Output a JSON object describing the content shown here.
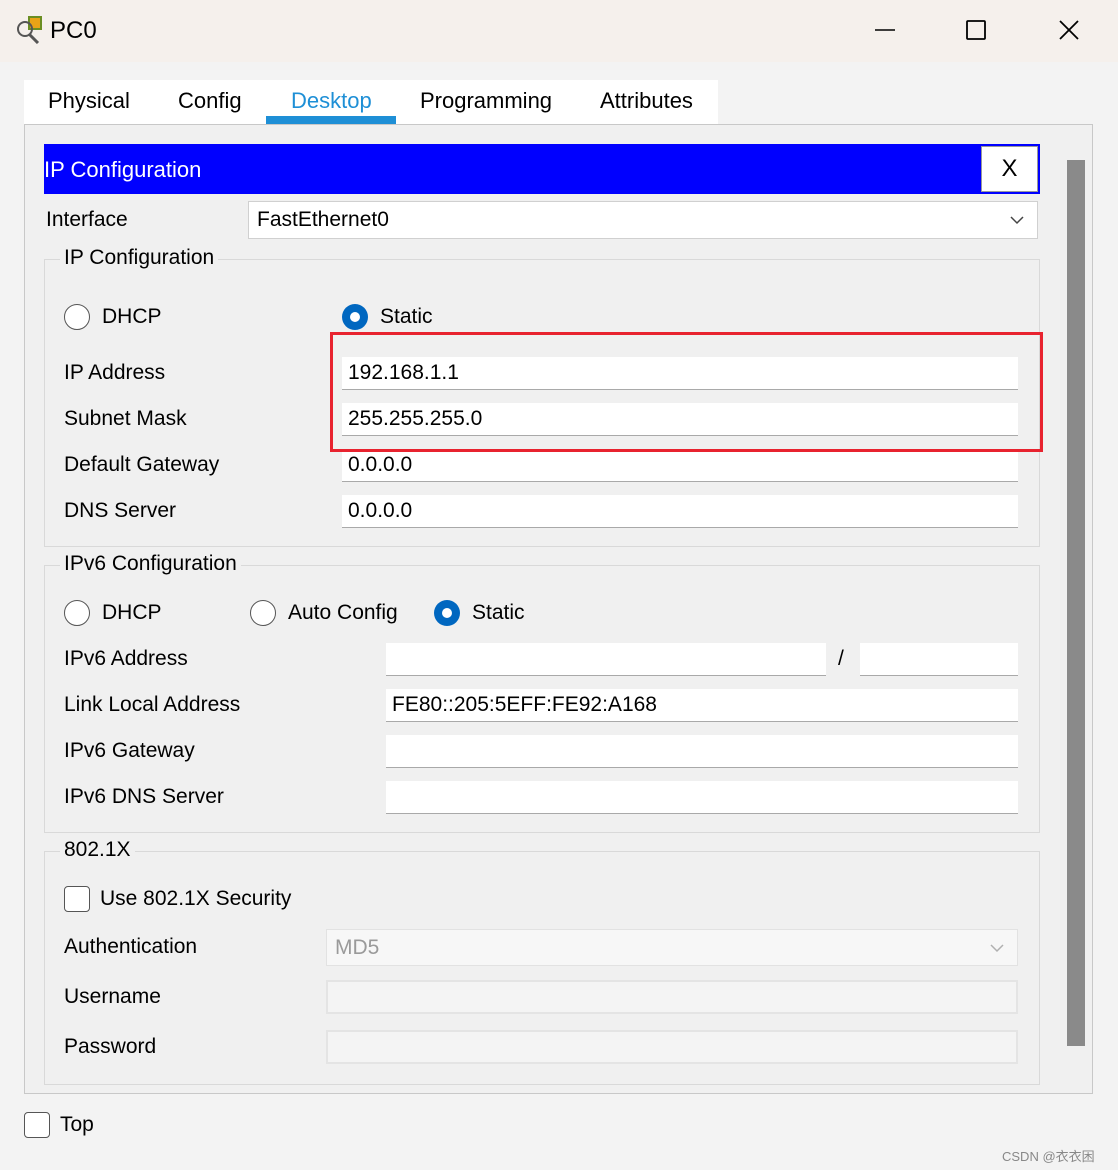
{
  "window": {
    "title": "PC0"
  },
  "tabs": [
    {
      "label": "Physical"
    },
    {
      "label": "Config"
    },
    {
      "label": "Desktop"
    },
    {
      "label": "Programming"
    },
    {
      "label": "Attributes"
    }
  ],
  "active_tab": "Desktop",
  "ip_config_panel": {
    "header_title": "IP Configuration",
    "close_label": "X"
  },
  "interface": {
    "label": "Interface",
    "selected": "FastEthernet0"
  },
  "ipv4": {
    "legend": "IP Configuration",
    "dhcp_label": "DHCP",
    "static_label": "Static",
    "mode": "Static",
    "ip_address": {
      "label": "IP Address",
      "value": "192.168.1.1"
    },
    "subnet_mask": {
      "label": "Subnet Mask",
      "value": "255.255.255.0"
    },
    "default_gateway": {
      "label": "Default Gateway",
      "value": "0.0.0.0"
    },
    "dns_server": {
      "label": "DNS Server",
      "value": "0.0.0.0"
    }
  },
  "ipv6": {
    "legend": "IPv6 Configuration",
    "dhcp_label": "DHCP",
    "auto_label": "Auto Config",
    "static_label": "Static",
    "mode": "Static",
    "address": {
      "label": "IPv6 Address",
      "value": "",
      "prefix": "",
      "separator": "/"
    },
    "link_local": {
      "label": "Link Local Address",
      "value": "FE80::205:5EFF:FE92:A168"
    },
    "gateway": {
      "label": "IPv6 Gateway",
      "value": ""
    },
    "dns": {
      "label": "IPv6 DNS Server",
      "value": ""
    }
  },
  "dot1x": {
    "legend": "802.1X",
    "use_security_label": "Use 802.1X Security",
    "use_security_checked": false,
    "authentication": {
      "label": "Authentication",
      "selected": "MD5"
    },
    "username": {
      "label": "Username",
      "value": ""
    },
    "password": {
      "label": "Password",
      "value": ""
    }
  },
  "footer": {
    "top_label": "Top",
    "top_checked": false
  },
  "watermark": "CSDN @衣衣困",
  "colors": {
    "accent": "#1e8fd6",
    "header_blue": "#0000ff",
    "radio_selected": "#0067c0",
    "highlight_red": "#e8232f"
  }
}
